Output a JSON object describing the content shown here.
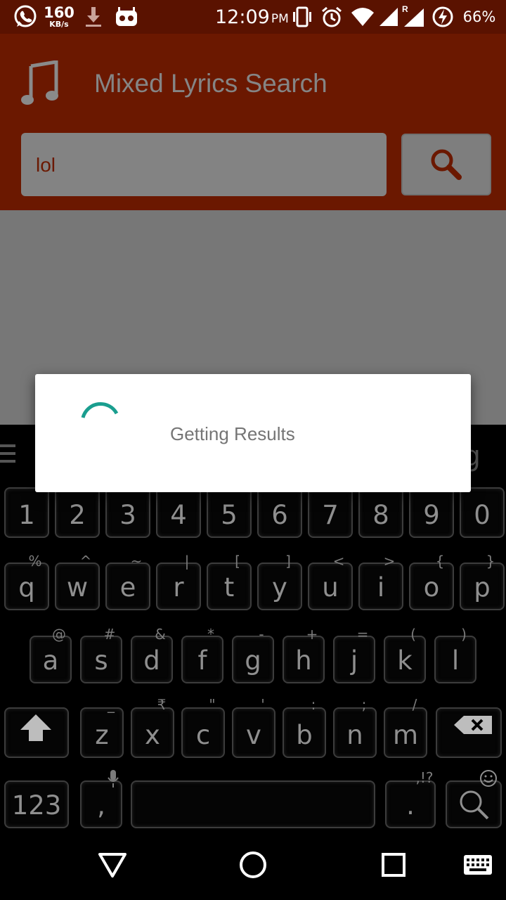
{
  "status_bar": {
    "speed_value": "160",
    "speed_unit": "KB/s",
    "time": "12:09",
    "ampm": "PM",
    "roaming_label": "R",
    "battery": "66%"
  },
  "app": {
    "title": "Mixed Lyrics Search",
    "search": {
      "value": "lol"
    },
    "colors": {
      "primary": "#6b1800",
      "primary_dark": "#5a1200",
      "accent": "#1a9e8f"
    }
  },
  "dialog": {
    "message": "Getting Results"
  },
  "keyboard": {
    "corner_key": "g",
    "number_row": [
      "1",
      "2",
      "3",
      "4",
      "5",
      "6",
      "7",
      "8",
      "9",
      "0"
    ],
    "row1": {
      "keys": [
        "q",
        "w",
        "e",
        "r",
        "t",
        "y",
        "u",
        "i",
        "o",
        "p"
      ],
      "hints": [
        "%",
        "^",
        "~",
        "|",
        "[",
        "]",
        "<",
        ">",
        "{",
        "}"
      ]
    },
    "row2": {
      "keys": [
        "a",
        "s",
        "d",
        "f",
        "g",
        "h",
        "j",
        "k",
        "l"
      ],
      "hints": [
        "@",
        "#",
        "&",
        "*",
        "-",
        "+",
        "=",
        "(",
        ")"
      ]
    },
    "row3": {
      "keys": [
        "z",
        "x",
        "c",
        "v",
        "b",
        "n",
        "m"
      ],
      "hints": [
        "_",
        "₹",
        "\"",
        "'",
        ":",
        ";",
        "/"
      ]
    },
    "bottom": {
      "mode_key": "123",
      "comma": ",",
      "period": ".",
      "period_hint": ",!?"
    }
  }
}
